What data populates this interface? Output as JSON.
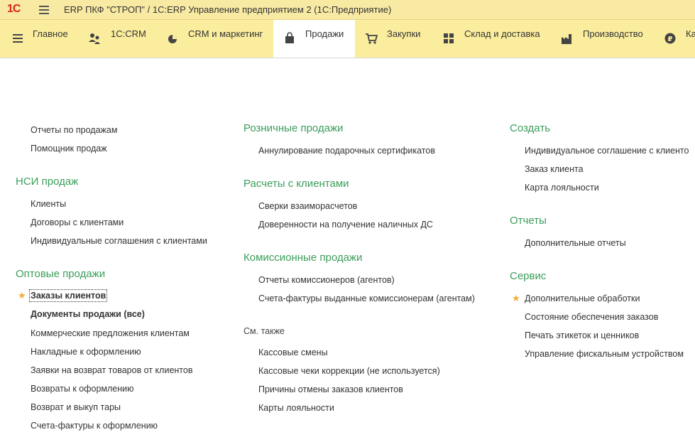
{
  "window": {
    "logo": "1С",
    "title": "ERP ПКФ \"СТРОП\" / 1С:ERP Управление предприятием 2  (1С:Предприятие)"
  },
  "sections": [
    {
      "label": "Главное",
      "icon": "menu-icon"
    },
    {
      "label": "1С:CRM",
      "icon": "users-icon"
    },
    {
      "label": "CRM и маркетинг",
      "icon": "pie-chart-icon"
    },
    {
      "label": "Продажи",
      "icon": "shopping-bag-icon"
    },
    {
      "label": "Закупки",
      "icon": "cart-icon"
    },
    {
      "label": "Склад и доставка",
      "icon": "warehouse-grid-icon"
    },
    {
      "label": "Производство",
      "icon": "factory-icon"
    },
    {
      "label": "Ка",
      "icon": "ruble-icon"
    }
  ],
  "active_section": "Продажи",
  "col1": {
    "top_links": [
      "Отчеты по продажам",
      "Помощник продаж"
    ],
    "nsi": {
      "title": "НСИ продаж",
      "links": [
        "Клиенты",
        "Договоры с клиентами",
        "Индивидуальные соглашения с клиентами"
      ]
    },
    "wholesale": {
      "title": "Оптовые продажи",
      "links": [
        "Заказы клиентов",
        "Документы продажи (все)",
        "Коммерческие предложения клиентам",
        "Накладные к оформлению",
        "Заявки на возврат товаров от клиентов",
        "Возвраты к оформлению",
        "Возврат и выкуп тары",
        "Счета-фактуры к оформлению"
      ]
    }
  },
  "col2": {
    "retail": {
      "title": "Розничные продажи",
      "links": [
        "Аннулирование подарочных сертификатов"
      ]
    },
    "settlements": {
      "title": "Расчеты с клиентами",
      "links": [
        "Сверки взаиморасчетов",
        "Доверенности на получение наличных ДС"
      ]
    },
    "commission": {
      "title": "Комиссионные продажи",
      "links": [
        "Отчеты комиссионеров (агентов)",
        "Счета-фактуры выданные комиссионерам (агентам)"
      ]
    },
    "see_also": {
      "title": "См. также",
      "links": [
        "Кассовые смены",
        "Кассовые чеки коррекции (не используется)",
        "Причины отмены заказов клиентов",
        "Карты лояльности"
      ]
    }
  },
  "col3": {
    "create": {
      "title": "Создать",
      "links": [
        "Индивидуальное соглашение с клиенто",
        "Заказ клиента",
        "Карта лояльности"
      ]
    },
    "reports": {
      "title": "Отчеты",
      "links": [
        "Дополнительные отчеты"
      ]
    },
    "service": {
      "title": "Сервис",
      "links": [
        "Дополнительные обработки",
        "Состояние обеспечения заказов",
        "Печать этикеток и ценников",
        "Управление фискальным устройством"
      ]
    }
  },
  "colors": {
    "titlebar": "#f9eaa3",
    "sections_bar": "#fbed9e",
    "group_header": "#3c9d5b",
    "favorite_star": "#f1ae2f",
    "logo": "#d7261e"
  }
}
